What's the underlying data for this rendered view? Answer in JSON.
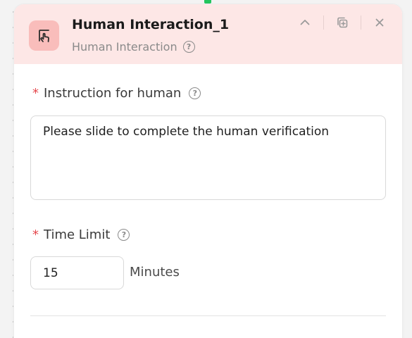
{
  "node": {
    "title": "Human Interaction_1",
    "subtitle": "Human Interaction",
    "icon": "hand-pointer-icon",
    "accent_color": "#fde7e6",
    "icon_bg_color": "#f9bdbb",
    "actions": [
      {
        "name": "collapse-button",
        "icon": "chevron-up-icon"
      },
      {
        "name": "duplicate-button",
        "icon": "copy-icon"
      },
      {
        "name": "close-button",
        "icon": "close-icon"
      }
    ]
  },
  "fields": {
    "instruction": {
      "label": "Instruction for human",
      "required": "*",
      "value": "Please slide to complete the human verification"
    },
    "time_limit": {
      "label": "Time Limit",
      "required": "*",
      "value": "15",
      "unit": "Minutes"
    }
  },
  "colors": {
    "required": "#e5484d",
    "connector": "#22c55e"
  }
}
